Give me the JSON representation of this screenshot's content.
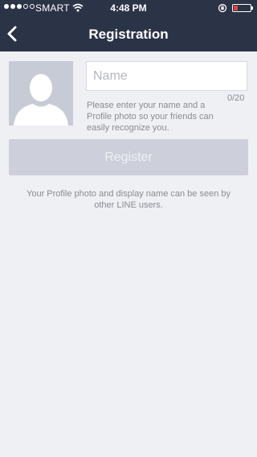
{
  "status_bar": {
    "carrier": "SMART",
    "time": "4:48 PM",
    "battery_color": "#e0433c"
  },
  "header": {
    "title": "Registration",
    "back_icon": "chevron-left-icon"
  },
  "profile": {
    "avatar_icon": "person-silhouette-icon",
    "name_placeholder": "Name",
    "name_value": "",
    "char_counter": "0/20",
    "helper_text": "Please enter your name and a Profile photo so your friends can easily recognize you."
  },
  "register_button": {
    "label": "Register",
    "enabled": false
  },
  "privacy_note": "Your Profile photo and display name can be seen by other LINE users.",
  "colors": {
    "header_bg": "#2b3347",
    "page_bg": "#eff0f4",
    "button_disabled": "#cdd0da"
  }
}
